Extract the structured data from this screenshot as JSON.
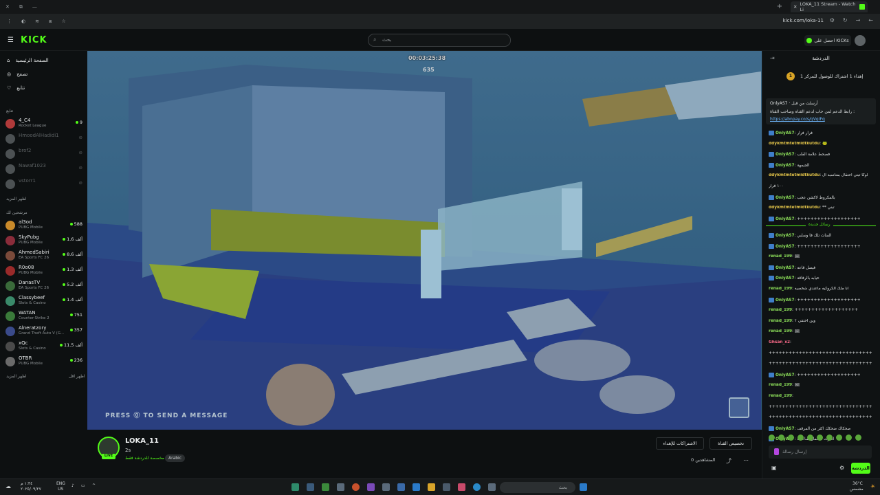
{
  "browser": {
    "tab_title": "LOKA_11 Stream - Watch Li",
    "url": "kick.com/loka-11"
  },
  "header": {
    "logo": "KICK",
    "search_placeholder": "بحث",
    "get_kicks": "احصل على KICKs"
  },
  "sidebar": {
    "nav": [
      {
        "label": "الصفحة الرئيسية",
        "icon": "home-icon"
      },
      {
        "label": "تصفح",
        "icon": "compass-icon"
      },
      {
        "label": "تتابع",
        "icon": "heart-icon"
      }
    ],
    "following_title": "تتابع",
    "following": [
      {
        "name": "4_C4",
        "game": "Rocket League",
        "viewers": "9",
        "live": true,
        "color": "#b03a3a"
      },
      {
        "name": "HmoodAlHadidi1",
        "game": "",
        "viewers": "",
        "live": false,
        "color": "#4c5153"
      },
      {
        "name": "brof2",
        "game": "",
        "viewers": "",
        "live": false,
        "color": "#4c5153"
      },
      {
        "name": "Nawaf1023",
        "game": "",
        "viewers": "",
        "live": false,
        "color": "#4c5153"
      },
      {
        "name": "vstorr1",
        "game": "",
        "viewers": "",
        "live": false,
        "color": "#4c5153"
      }
    ],
    "show_more_following": "اظهر المزيد",
    "recommended_title": "مرشحين لك",
    "recommended": [
      {
        "name": "al3od",
        "game": "PUBG Mobile",
        "viewers": "588",
        "color": "#c98a2a"
      },
      {
        "name": "SkyPubg",
        "game": "PUBG Mobile",
        "viewers": "1.6 ألف",
        "color": "#8a2c3a"
      },
      {
        "name": "AhmedSabiri",
        "game": "EA Sports FC 26",
        "viewers": "8.6 ألف",
        "color": "#7a4a3a"
      },
      {
        "name": "R0o08",
        "game": "PUBG Mobile",
        "viewers": "1.3 ألف",
        "color": "#9a2a2a"
      },
      {
        "name": "DanasTV",
        "game": "EA Sports FC 26",
        "viewers": "5.2 ألف",
        "color": "#3a6a3a"
      },
      {
        "name": "Classybeef",
        "game": "Slots & Casino",
        "viewers": "1.4 ألف",
        "color": "#3a8a6a"
      },
      {
        "name": "WATAN",
        "game": "Counter-Strike 2",
        "viewers": "751",
        "color": "#3a7a3a"
      },
      {
        "name": "Alneratzory",
        "game": "Grand Theft Auto V (G...",
        "viewers": "357",
        "color": "#3a4a8a"
      },
      {
        "name": "xQc",
        "game": "Slots & Casino",
        "viewers": "11.5 ألف",
        "color": "#4a4a4a"
      },
      {
        "name": "OTBR",
        "game": "PUBG Mobile",
        "viewers": "236",
        "color": "#6a6a6a"
      }
    ],
    "show_more": "اظهر المزيد",
    "show_less": "اظهر اقل"
  },
  "video": {
    "timer": "00:03:25:38",
    "score": "635",
    "overlay_text": "PRESS ⓪ TO SEND A MESSAGE"
  },
  "stream": {
    "name": "LOKA_11",
    "title": "2s",
    "category": "مخصصة للدردشة فقط",
    "language": "Arabic",
    "live_label": "LIVE",
    "subscriptions_button": "الاشتراكات للإهداء",
    "customize_button": "تخصيص القناة",
    "viewers": "0 المشاهدين"
  },
  "chat": {
    "title": "الدردشة",
    "goal": "إهداء 1 اشتراك للوصول للمركز 1",
    "goal_rank": "1",
    "pinned": {
      "user": "OnlyAS7",
      "time": "أرسلت من قبل",
      "message": "رابط الدعم لمن حاب لدعم القناه وصاحب القناة :",
      "link": "https://abnpay.co/s/gVgIFq"
    },
    "new_messages": "رسائل جديدة",
    "messages": [
      {
        "user": "OnlyAS7",
        "text": "فرار فرار",
        "badge": true,
        "color": "g"
      },
      {
        "user": "ddykmtmtetmidtkutdu",
        "text": "🐸",
        "badge": false,
        "color": "y"
      },
      {
        "user": "OnlyAS7",
        "text": "فصحط علامة القلب",
        "badge": true,
        "color": "g"
      },
      {
        "user": "OnlyAS7",
        "text": "الجيمهة",
        "badge": true,
        "color": "g"
      },
      {
        "user": "ddykmtmtetmidtkutdu",
        "text": "لوكا تبني احتفال بمناسبه ال",
        "badge": false,
        "color": "y"
      },
      {
        "user": "",
        "text": "١٠٠ فرار",
        "badge": false,
        "color": "y"
      },
      {
        "user": "OnlyAS7",
        "text": "بالمكروط لاكشن عجب",
        "badge": true,
        "color": "g"
      },
      {
        "user": "ddykmtmtetmidtkutdu",
        "text": "** تبني",
        "badge": false,
        "color": "y"
      },
      {
        "user": "OnlyAS7",
        "text": "+++++++++++++++++++",
        "badge": true,
        "color": "g"
      },
      {
        "user": "OnlyAS7",
        "text": "الفنات تلك فا وسلبي",
        "badge": true,
        "color": "g"
      },
      {
        "user": "OnlyAS7",
        "text": "+++++++++++++++++++",
        "badge": true,
        "color": "g"
      },
      {
        "user": "renad_199",
        "text": "🖼",
        "badge": false,
        "color": "g"
      },
      {
        "user": "OnlyAS7",
        "text": "فيصل قاعه",
        "badge": true,
        "color": "g"
      },
      {
        "user": "OnlyAS7",
        "text": "خيابه بالرفاقة",
        "badge": true,
        "color": "g"
      },
      {
        "user": "renad_199",
        "text": "انا ملك الكروكيه ماعندي شخصيه",
        "badge": false,
        "color": "g"
      },
      {
        "user": "OnlyAS7",
        "text": "+++++++++++++++++++",
        "badge": true,
        "color": "g"
      },
      {
        "user": "renad_199",
        "text": "+++++++++++++++++++",
        "badge": false,
        "color": "g"
      },
      {
        "user": "renad_199",
        "text": "وين اختفي ؟",
        "badge": false,
        "color": "g"
      },
      {
        "user": "renad_199",
        "text": "🖼",
        "badge": false,
        "color": "g"
      },
      {
        "user": "Ghsan_x2",
        "text": "",
        "badge": false,
        "color": "r"
      },
      {
        "user": "",
        "text": "+++++++++++++++++++++++++++++++++",
        "badge": false,
        "color": "g"
      },
      {
        "user": "",
        "text": "+++++++++++++++++++++++++++++++++",
        "badge": false,
        "color": "g"
      },
      {
        "user": "OnlyAS7",
        "text": "+++++++++++++++++++",
        "badge": true,
        "color": "g"
      },
      {
        "user": "renad_199",
        "text": "🖼",
        "badge": false,
        "color": "g"
      },
      {
        "user": "renad_199",
        "text": "",
        "badge": false,
        "color": "g"
      },
      {
        "user": "",
        "text": "+++++++++++++++++++++++++++++++++",
        "badge": false,
        "color": "g"
      },
      {
        "user": "",
        "text": "+++++++++++++++++++++++++++++++++",
        "badge": false,
        "color": "g"
      },
      {
        "user": "OnlyAS7",
        "text": "صحكاك ضحكك اكثر من المرقف",
        "badge": true,
        "color": "g"
      },
      {
        "user": "OnlyAS7",
        "text": "الفرت ها لمان ساعات",
        "badge": true,
        "color": "g"
      }
    ],
    "input_placeholder": "إرسال رسالة",
    "send_label": "الدردشة"
  },
  "taskbar": {
    "search_placeholder": "بحث",
    "lang": "ENG",
    "region": "US",
    "time": "١:٣٤ م",
    "date": "٢٠٢٥/٠٩/٢٧",
    "weather": "36°C",
    "weather_desc": "مشمس"
  }
}
